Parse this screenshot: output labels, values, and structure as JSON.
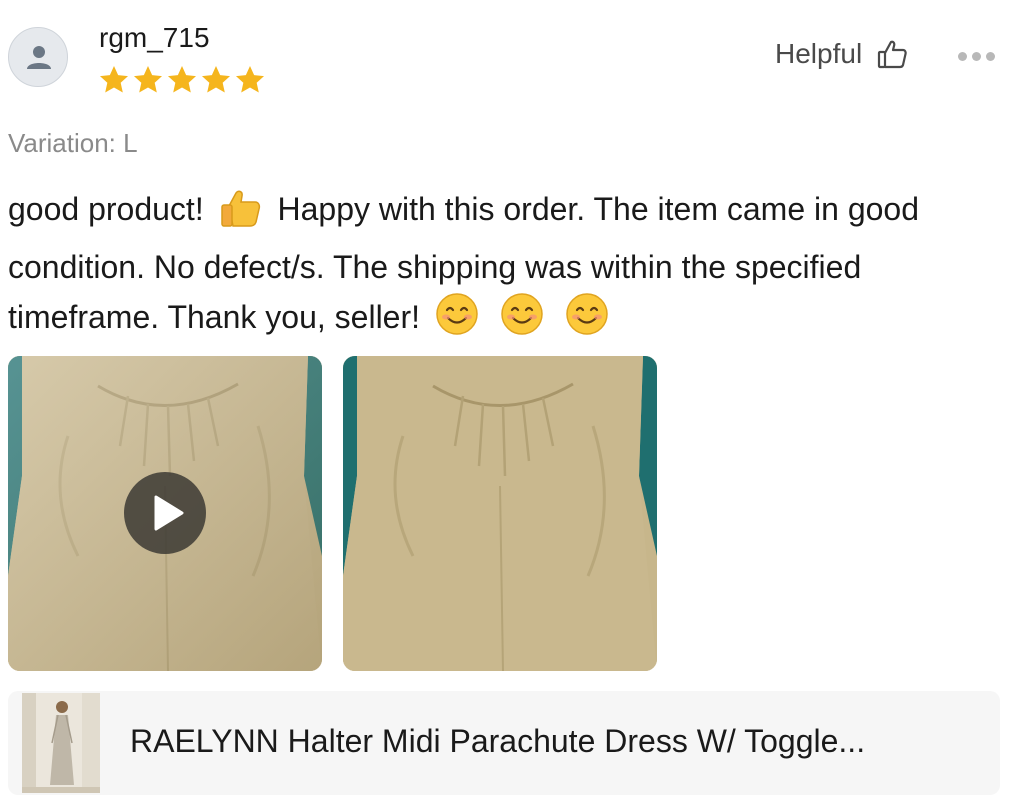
{
  "review": {
    "username": "rgm_715",
    "rating": 5,
    "rating_max": 5,
    "helpful_label": "Helpful",
    "variation": "Variation: L",
    "text_parts": {
      "a": "good product!",
      "b": "Happy with this order. The item came in good condition. No defect/s. The shipping was within the specified timeframe. Thank you, seller!"
    },
    "emojis": [
      "thumbs-up",
      "smiling-face",
      "smiling-face",
      "smiling-face"
    ]
  },
  "media": [
    {
      "kind": "video"
    },
    {
      "kind": "photo"
    }
  ],
  "product": {
    "title": "RAELYNN Halter Midi Parachute Dress W/ Toggle..."
  },
  "colors": {
    "star": "#f5b51d",
    "accent_text": "#1a1a1a",
    "muted_text": "#8a8a8a",
    "fabric": "#c9b88e",
    "backdrop": "#1f6f6f"
  }
}
